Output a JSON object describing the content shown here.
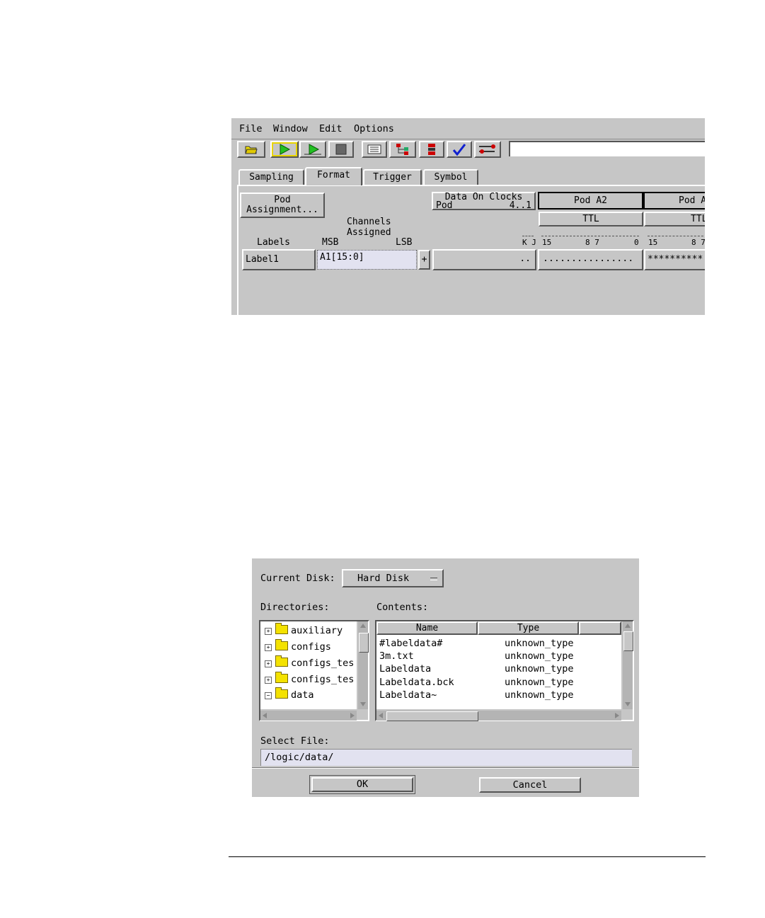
{
  "menu": [
    "File",
    "Window",
    "Edit",
    "Options"
  ],
  "toolbar": {
    "buttons": [
      "open-folder-icon",
      "run-icon",
      "run-repetitive-icon",
      "stop-icon",
      "listing-icon",
      "overview-icon",
      "waveform-icon",
      "check-icon",
      "tools-icon"
    ]
  },
  "tabs": [
    "Sampling",
    "Format",
    "Trigger",
    "Symbol"
  ],
  "format": {
    "pod_assignment_line1": "Pod",
    "pod_assignment_line2": "Assignment...",
    "data_on_clocks_line1": "Data On Clocks",
    "data_on_clocks_line2": "Pod",
    "data_on_clocks_range": "4..1",
    "pod_a2": "Pod A2",
    "pod_next": "Pod A",
    "threshold_a2": "TTL",
    "threshold_next": "TTL",
    "channels_assigned_line1": "Channels",
    "channels_assigned_line2": "Assigned",
    "labels_header": "Labels",
    "msb_header": "MSB",
    "lsb_header": "LSB",
    "kj_header": "K J",
    "bits_a2": [
      "15",
      "8 7",
      "0"
    ],
    "bits_next": [
      "15",
      "8 7"
    ],
    "label_name": "Label1",
    "label_channels": "A1[15:0]",
    "plus": "+",
    "clock_bits": "..",
    "pod_a2_bits": "................",
    "pod_next_bits": "**********"
  },
  "dialog": {
    "current_disk_label": "Current Disk:",
    "current_disk_value": "Hard Disk",
    "directories_label": "Directories:",
    "contents_label": "Contents:",
    "directories": [
      "auxiliary",
      "configs",
      "configs_tes",
      "configs_tes",
      "data"
    ],
    "columns": [
      "Name",
      "Type"
    ],
    "files": [
      {
        "name": "#labeldata#",
        "type": "unknown_type"
      },
      {
        "name": "3m.txt",
        "type": "unknown_type"
      },
      {
        "name": "Labeldata",
        "type": "unknown_type"
      },
      {
        "name": "Labeldata.bck",
        "type": "unknown_type"
      },
      {
        "name": "Labeldata~",
        "type": "unknown_type"
      }
    ],
    "select_file_label": "Select File:",
    "select_file_value": "/logic/data/",
    "ok": "OK",
    "cancel": "Cancel"
  }
}
